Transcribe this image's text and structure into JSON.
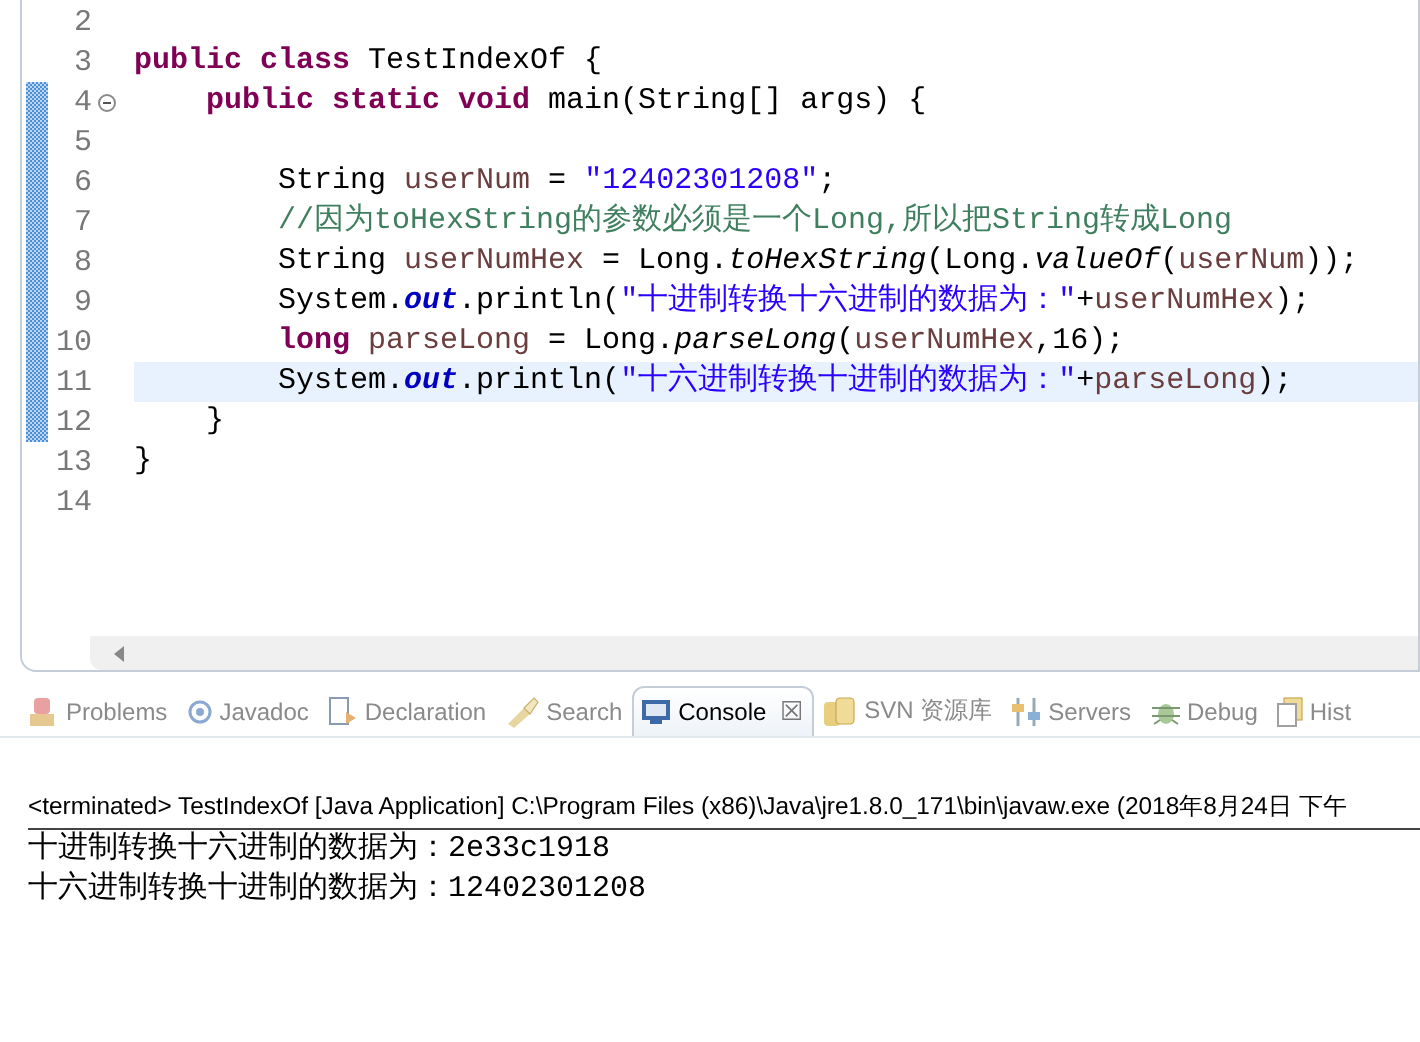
{
  "editor": {
    "lines": [
      {
        "number": "2",
        "changed": false,
        "current": false,
        "fold": false
      },
      {
        "number": "3",
        "changed": false,
        "current": false,
        "fold": false,
        "tokens": [
          {
            "kind": "keyword",
            "text": "public class"
          },
          {
            "kind": "plain",
            "text": " TestIndexOf {"
          }
        ]
      },
      {
        "number": "4",
        "changed": true,
        "current": false,
        "fold": true,
        "tokens": [
          {
            "kind": "keyword",
            "text": "    public static void"
          },
          {
            "kind": "plain",
            "text": " main(String[] args) {"
          }
        ]
      },
      {
        "number": "5",
        "changed": true,
        "current": false,
        "fold": false
      },
      {
        "number": "6",
        "changed": true,
        "current": false,
        "fold": false,
        "tokens": [
          {
            "kind": "plain",
            "text": "        String "
          },
          {
            "kind": "variable",
            "text": "userNum"
          },
          {
            "kind": "plain",
            "text": " = "
          },
          {
            "kind": "string",
            "text": "\"12402301208\""
          },
          {
            "kind": "plain",
            "text": ";"
          }
        ]
      },
      {
        "number": "7",
        "changed": true,
        "current": false,
        "fold": false,
        "tokens": [
          {
            "kind": "comment",
            "text": "        //因为toHexString的参数必须是一个Long,所以把String转成Long"
          }
        ]
      },
      {
        "number": "8",
        "changed": true,
        "current": false,
        "fold": false,
        "tokens": [
          {
            "kind": "plain",
            "text": "        String "
          },
          {
            "kind": "variable",
            "text": "userNumHex"
          },
          {
            "kind": "plain",
            "text": " = Long."
          },
          {
            "kind": "static-method",
            "text": "toHexString"
          },
          {
            "kind": "plain",
            "text": "(Long."
          },
          {
            "kind": "static-method",
            "text": "valueOf"
          },
          {
            "kind": "plain",
            "text": "("
          },
          {
            "kind": "variable",
            "text": "userNum"
          },
          {
            "kind": "plain",
            "text": "));"
          }
        ]
      },
      {
        "number": "9",
        "changed": true,
        "current": false,
        "fold": false,
        "tokens": [
          {
            "kind": "plain",
            "text": "        System."
          },
          {
            "kind": "field",
            "text": "out"
          },
          {
            "kind": "plain",
            "text": ".println("
          },
          {
            "kind": "string",
            "text": "\"十进制转换十六进制的数据为：\""
          },
          {
            "kind": "plain",
            "text": "+"
          },
          {
            "kind": "variable",
            "text": "userNumHex"
          },
          {
            "kind": "plain",
            "text": ");"
          }
        ]
      },
      {
        "number": "10",
        "changed": true,
        "current": false,
        "fold": false,
        "tokens": [
          {
            "kind": "keyword",
            "text": "        long"
          },
          {
            "kind": "variable",
            "text": " parseLong"
          },
          {
            "kind": "plain",
            "text": " = Long."
          },
          {
            "kind": "static-method",
            "text": "parseLong"
          },
          {
            "kind": "plain",
            "text": "("
          },
          {
            "kind": "variable",
            "text": "userNumHex"
          },
          {
            "kind": "plain",
            "text": ",16);"
          }
        ]
      },
      {
        "number": "11",
        "changed": true,
        "current": true,
        "fold": false,
        "tokens": [
          {
            "kind": "plain",
            "text": "        System."
          },
          {
            "kind": "field",
            "text": "out"
          },
          {
            "kind": "plain",
            "text": ".println("
          },
          {
            "kind": "string",
            "text": "\"十六进制转换十进制的数据为：\""
          },
          {
            "kind": "plain",
            "text": "+"
          },
          {
            "kind": "variable",
            "text": "parseLong"
          },
          {
            "kind": "plain",
            "text": ");"
          }
        ]
      },
      {
        "number": "12",
        "changed": true,
        "current": false,
        "fold": false,
        "tokens": [
          {
            "kind": "plain",
            "text": "    }"
          }
        ]
      },
      {
        "number": "13",
        "changed": false,
        "current": false,
        "fold": false,
        "tokens": [
          {
            "kind": "plain",
            "text": "}"
          }
        ]
      },
      {
        "number": "14",
        "changed": false,
        "current": false,
        "fold": false
      }
    ]
  },
  "views": {
    "tabs": [
      {
        "label": "Problems",
        "selected": false
      },
      {
        "label": "Javadoc",
        "selected": false
      },
      {
        "label": "Declaration",
        "selected": false
      },
      {
        "label": "Search",
        "selected": false
      },
      {
        "label": "Console",
        "selected": true,
        "close": "☒"
      },
      {
        "label": "SVN 资源库",
        "selected": false
      },
      {
        "label": "Servers",
        "selected": false
      },
      {
        "label": "Debug",
        "selected": false
      },
      {
        "label": "Hist",
        "selected": false
      }
    ]
  },
  "console": {
    "header": "<terminated> TestIndexOf [Java Application] C:\\Program Files (x86)\\Java\\jre1.8.0_171\\bin\\javaw.exe (2018年8月24日 下午",
    "output": [
      "十进制转换十六进制的数据为：2e33c1918",
      "十六进制转换十进制的数据为：12402301208"
    ]
  }
}
